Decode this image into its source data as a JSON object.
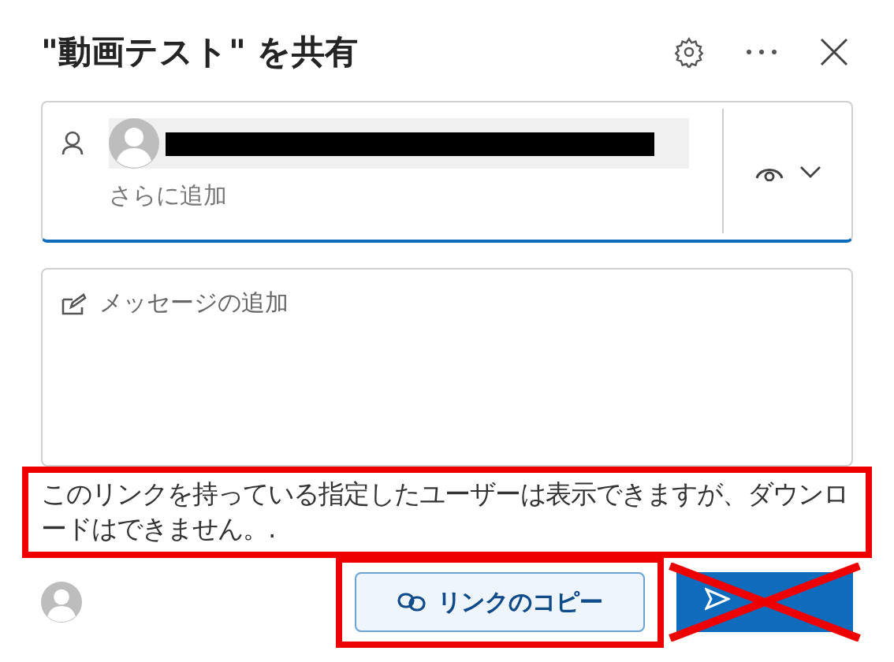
{
  "dialog": {
    "title": "\"動画テスト\" を共有"
  },
  "recipients": {
    "placeholder": "さらに追加"
  },
  "message": {
    "placeholder": "メッセージの追加"
  },
  "info": "このリンクを持っている指定したユーザーは表示できますが、ダウンロードはできません。.",
  "buttons": [
    {
      "kind": "copy",
      "label": "リンクのコピー"
    },
    {
      "kind": "send"
    }
  ]
}
